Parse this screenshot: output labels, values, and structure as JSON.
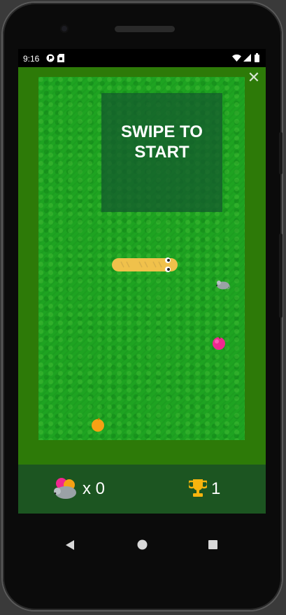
{
  "status": {
    "time": "9:16",
    "icons": [
      "settings-icon",
      "sim-card-icon",
      "wifi-icon",
      "signal-icon",
      "battery-icon"
    ]
  },
  "game": {
    "close_icon": "close-icon",
    "start_text": "SWIPE TO START",
    "colors": {
      "field": "#1ea321",
      "border": "#2d7a08",
      "panel": "#145a2d",
      "snake": "#f0c14b",
      "bar": "#1c5521"
    },
    "items": [
      "snake",
      "mouse",
      "pink-fruit",
      "orange-fruit"
    ]
  },
  "score": {
    "eaten_label": "x 0",
    "best": "1"
  },
  "nav": {
    "back_icon": "back-icon",
    "home_icon": "home-icon",
    "recents_icon": "recents-icon"
  }
}
